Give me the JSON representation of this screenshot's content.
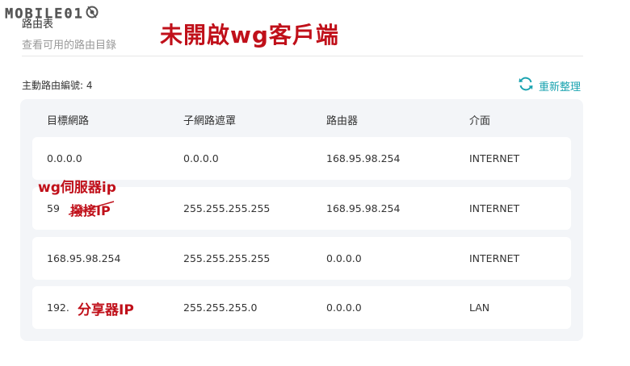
{
  "watermark": {
    "text": "MOBILE01"
  },
  "header": {
    "title": "路由表",
    "subtitle": "查看可用的路由目錄"
  },
  "annotations": {
    "title": "未開啟wg客戶端",
    "wg_server_ip": "wg伺服器ip",
    "dialup_ip": "撥接IP",
    "router_ip": "分享器IP"
  },
  "summary": {
    "label": "主動路由編號: 4"
  },
  "refresh": {
    "label": "重新整理",
    "icon": "refresh-icon",
    "color": "#1aa3b0"
  },
  "table": {
    "headers": [
      "目標網路",
      "子網路遮罩",
      "路由器",
      "介面"
    ],
    "rows": [
      [
        "0.0.0.0",
        "0.0.0.0",
        "168.95.98.254",
        "INTERNET"
      ],
      [
        "59",
        "255.255.255.255",
        "168.95.98.254",
        "INTERNET"
      ],
      [
        "168.95.98.254",
        "255.255.255.255",
        "0.0.0.0",
        "INTERNET"
      ],
      [
        "192.",
        "255.255.255.0",
        "0.0.0.0",
        "LAN"
      ]
    ]
  },
  "colors": {
    "annotation": "#c0101a",
    "card_bg": "#f3f5f8",
    "accent": "#1aa3b0"
  }
}
